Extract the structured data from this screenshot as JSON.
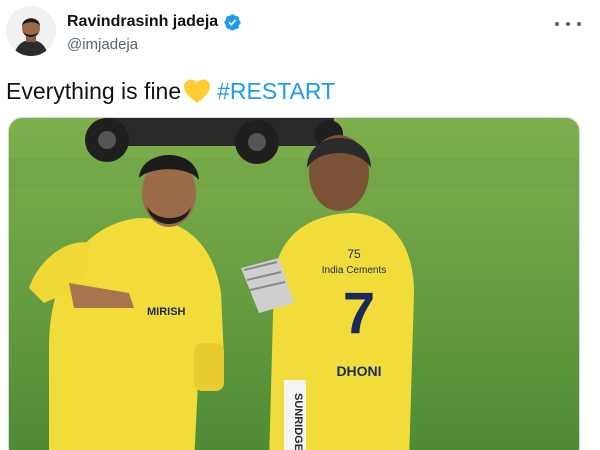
{
  "author": {
    "display_name": "Ravindrasinh jadeja",
    "handle": "@imjadeja",
    "verified": true,
    "avatar_icon": "profile-photo"
  },
  "tweet": {
    "text": "Everything is fine",
    "emoji_icon": "yellow-heart-icon",
    "hashtag": "#RESTART"
  },
  "media": {
    "kind": "photo",
    "jersey_number": "7",
    "jersey_name": "DHONI",
    "jersey_sponsor": "India Cements",
    "jersey_badge": "75",
    "trouser_text": "SUNRIDGE",
    "shirt_text": "MIRISH"
  },
  "colors": {
    "accent": "#1d9bf0",
    "heart": "#ffcc33",
    "jersey_yellow": "#f2dc3a",
    "pitch_green": "#5f9a3e"
  },
  "icons": {
    "menu": "more-horizontal-icon",
    "verified": "verified-badge-icon"
  }
}
